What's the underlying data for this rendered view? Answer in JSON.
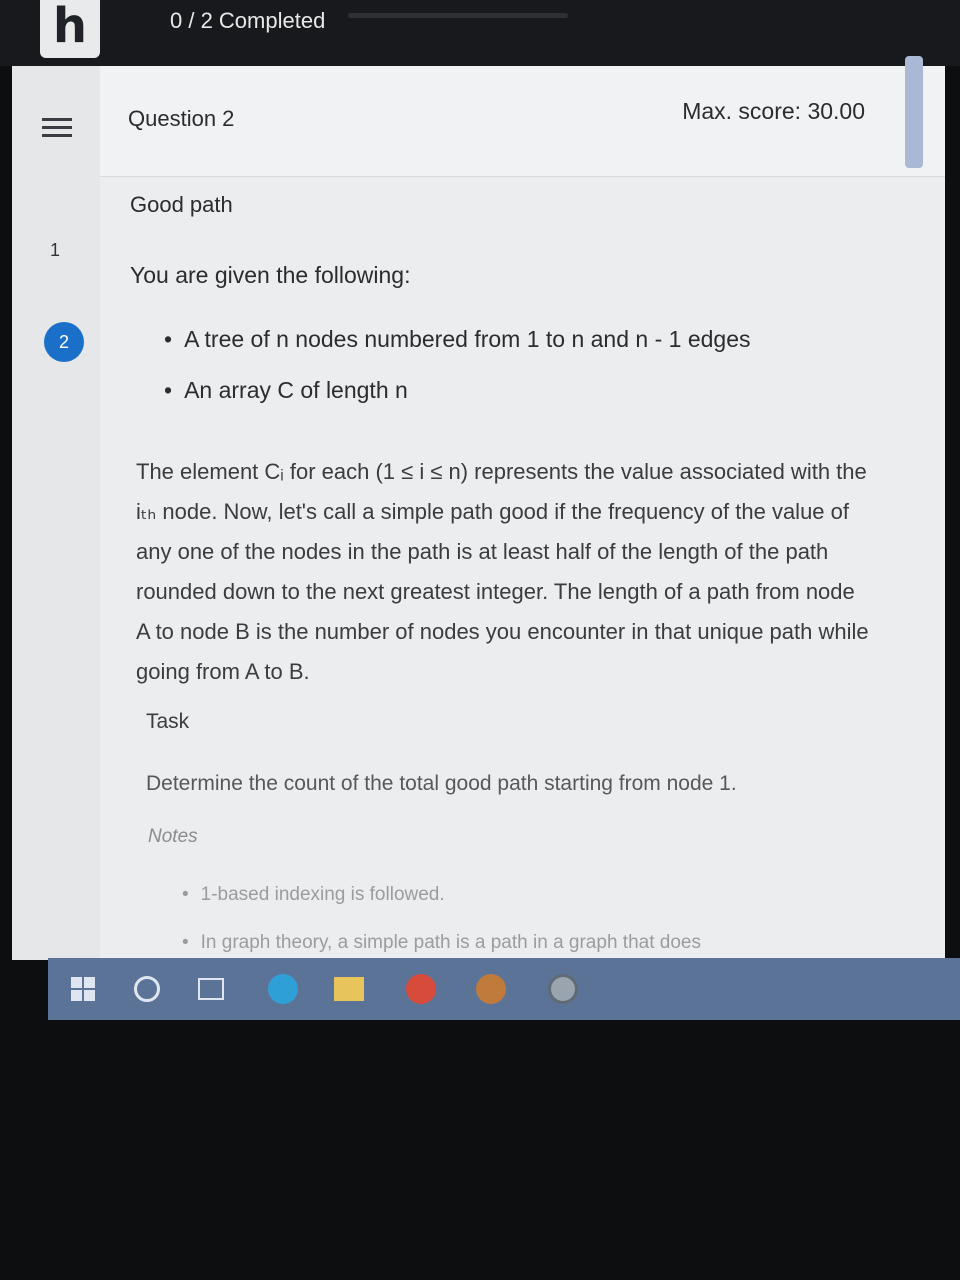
{
  "header": {
    "logo_letter": "h",
    "progress_label": "0 / 2 Completed",
    "progress_fraction": 0.0
  },
  "sidebar": {
    "questions": [
      {
        "number": "1",
        "active": false
      },
      {
        "number": "2",
        "active": true
      }
    ]
  },
  "question": {
    "title": "Question  2",
    "max_score": "Max. score: 30.00"
  },
  "problem": {
    "title": "Good path",
    "intro": "You are given the following:",
    "bullets": [
      "A tree of n nodes numbered from 1 to n and n - 1 edges",
      "An array C of length n"
    ],
    "paragraph": "The element Cᵢ for each (1 ≤ i ≤ n) represents the value associated with the iₜₕ node. Now, let's call a simple path good if the frequency of the value of any one of the nodes in the path is at least half of the length of the path rounded down to the next greatest integer. The length of a path from node A to node B is the number of nodes you encounter in that unique path while going from A to B.",
    "task_heading": "Task",
    "task_body": "Determine the count of the total good path starting from node 1.",
    "notes_heading": "Notes",
    "notes": [
      "1-based indexing is followed.",
      "In graph theory, a simple path is a path in a graph that does"
    ]
  },
  "taskbar": {
    "icons": [
      "windows-start-icon",
      "search-icon",
      "task-view-icon",
      "edge-browser-icon",
      "file-explorer-icon",
      "app-icon",
      "app-icon",
      "chrome-icon"
    ]
  },
  "colors": {
    "active_question": "#1a6fc9",
    "taskbar": "#5c7398"
  }
}
